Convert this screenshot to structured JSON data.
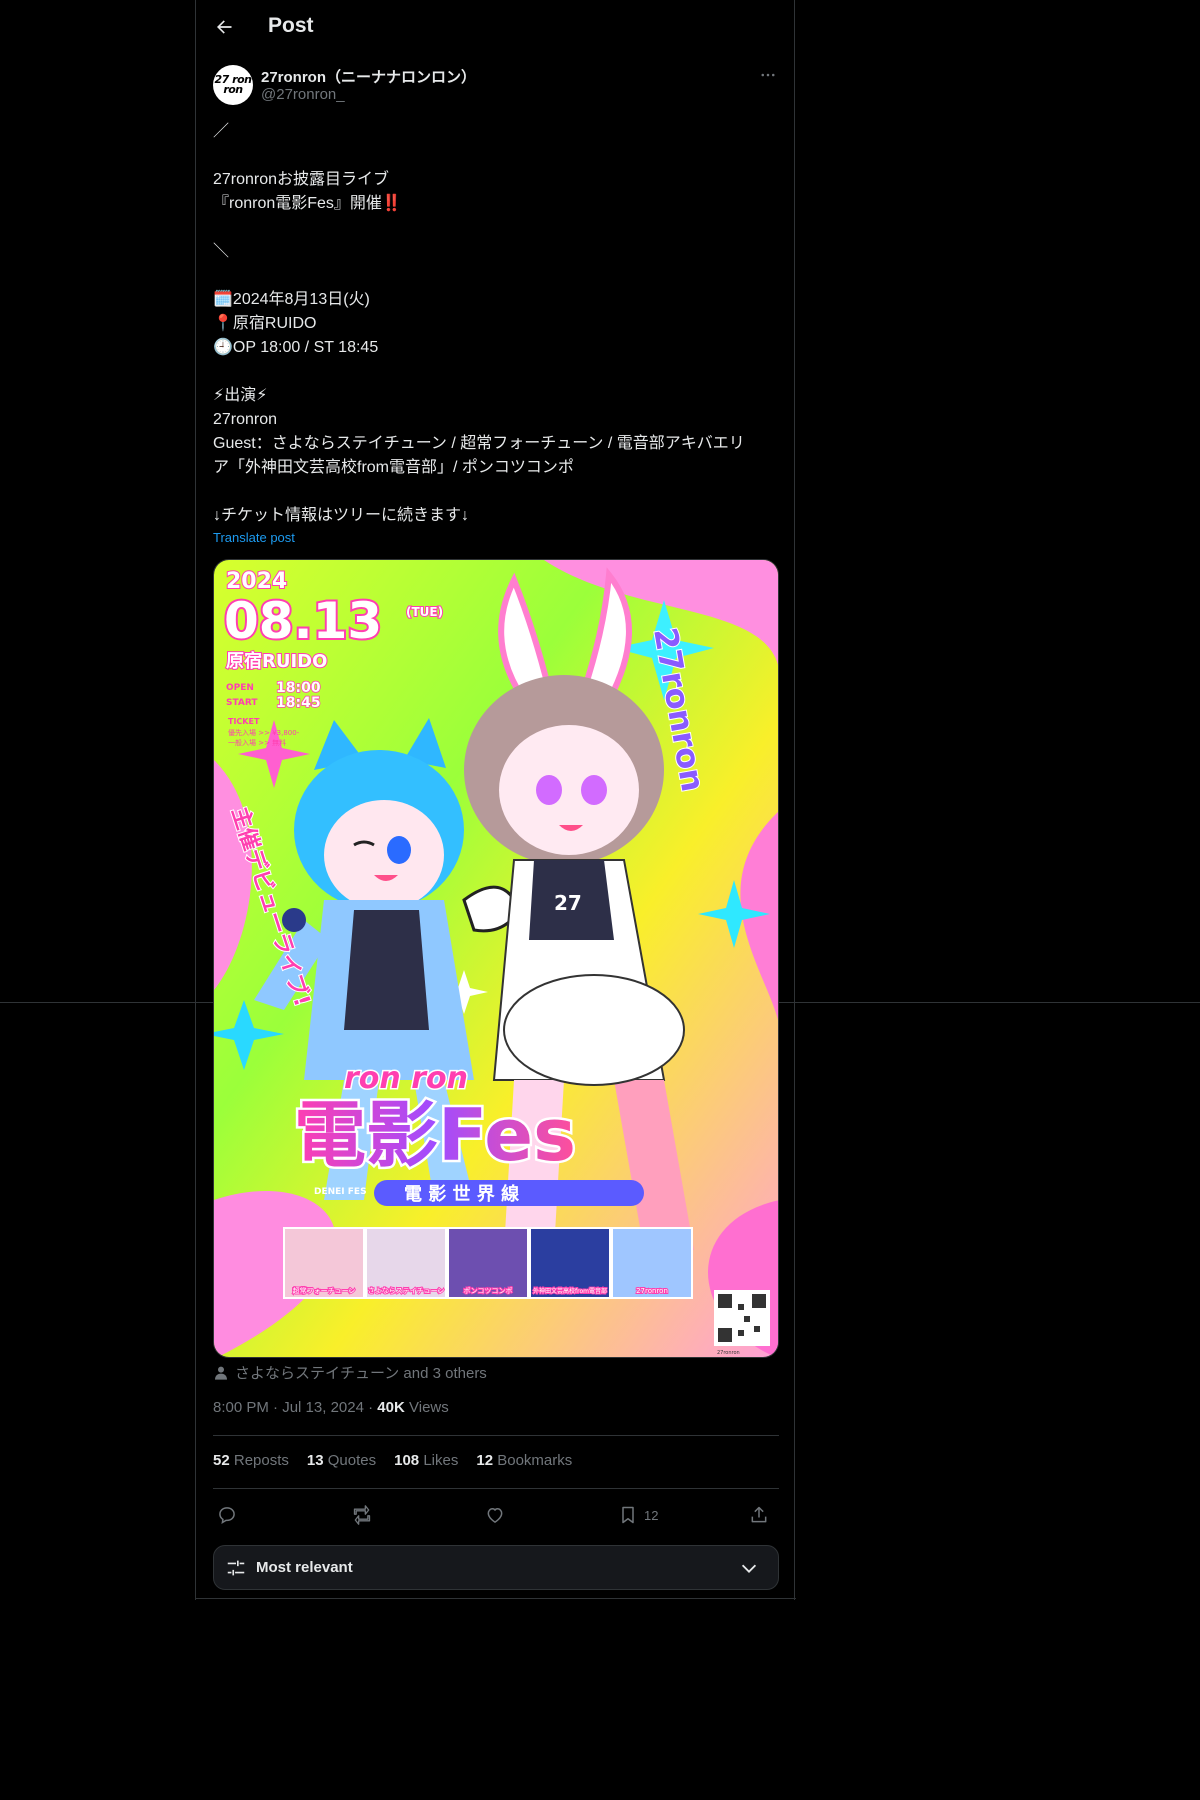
{
  "header": {
    "title": "Post",
    "back_icon": "arrow-left-icon"
  },
  "author": {
    "display_name": "27ronron（ニーナナロンロン）",
    "handle": "@27ronron_",
    "avatar_text": "27 ron ron"
  },
  "tweet": {
    "lines": [
      "／",
      "",
      "27ronronお披露目ライブ",
      "『ronron電影Fes』開催‼️",
      "",
      "＼",
      "",
      "🗓️2024年8月13日(火)",
      "📍原宿RUIDO",
      "🕘OP 18:00 / ST 18:45",
      "",
      "⚡出演⚡",
      "27ronron",
      "Guest：さよならステイチューン / 超常フォーチューン / 電音部アキバエリ",
      "ア「外神田文芸高校from電音部」/ ポンコツコンポ",
      "",
      "↓チケット情報はツリーに続きます↓"
    ],
    "translate_label": "Translate post"
  },
  "media": {
    "poster": {
      "year": "2024",
      "date": "08.13",
      "day": "(TUE)",
      "venue": "原宿RUIDO",
      "open_label": "OPEN",
      "open_time": "18:00",
      "start_label": "START",
      "start_time": "18:45",
      "ticket_label": "TICKET",
      "ticket_line1": "優先入場 >> ¥3,800-",
      "ticket_line2": "一般入場 >> 無料",
      "side_text": "主催デビューライブ!",
      "group_vertical": "27ronron",
      "logo_top": "ron ron",
      "logo_main": "電影Fes",
      "logo_sub": "電 影 世 界 線",
      "logo_romaji": "DENEI FES",
      "lineup": [
        "超常フォーチューン",
        "さよならステイチューン",
        "ポンコツコンポ",
        "外神田文芸高校from電音部",
        "27ronron"
      ],
      "qr_caption": "27ronron"
    }
  },
  "tagged": {
    "text": "さよならステイチューン and 3 others",
    "icon": "person-icon"
  },
  "meta": {
    "time": "8:00 PM",
    "dot": "·",
    "date": "Jul 13, 2024",
    "views_count": "40K",
    "views_label": "Views"
  },
  "stats": {
    "reposts_count": "52",
    "reposts_label": "Reposts",
    "quotes_count": "13",
    "quotes_label": "Quotes",
    "likes_count": "108",
    "likes_label": "Likes",
    "bookmarks_count": "12",
    "bookmarks_label": "Bookmarks"
  },
  "actions": {
    "bookmark_count": "12"
  },
  "sort": {
    "label": "Most relevant"
  },
  "colors": {
    "background": "#000000",
    "text": "#e7e9ea",
    "muted": "#71767b",
    "border": "#2f3336",
    "link": "#1d9bf0"
  }
}
